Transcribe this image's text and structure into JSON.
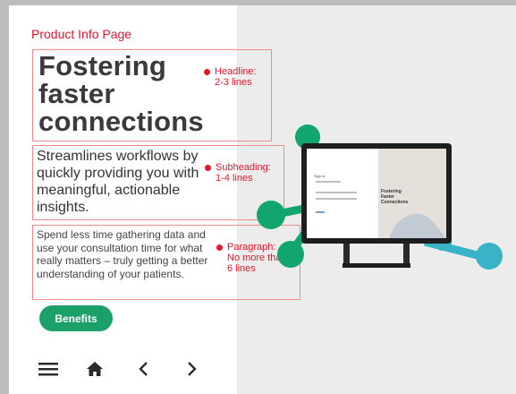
{
  "page_label": "Product Info Page",
  "headline": "Fostering faster connections",
  "subheading": "Streamlines workflows by quickly providing you with meaningful, actionable insights.",
  "paragraph": "Spend less time gathering data and use your consultation time for what really matters – truly getting a better understanding of your patients.",
  "notes": {
    "headline": "Headline:\n2-3 lines",
    "subheading": "Subheading:\n1-4 lines",
    "paragraph": "Paragraph:\nNo more than\n6 lines"
  },
  "button_label": "Benefits",
  "nav": [
    "menu-icon",
    "home-icon",
    "chevron-left-icon",
    "chevron-right-icon"
  ],
  "device_screen": {
    "signin": "Sign in",
    "headline": "Fostering Faster Connections"
  },
  "colors": {
    "accent_red": "#e3162a",
    "button_green": "#1ba06a",
    "bubble_green": "#12a66f",
    "bubble_teal": "#3ab2c8"
  }
}
